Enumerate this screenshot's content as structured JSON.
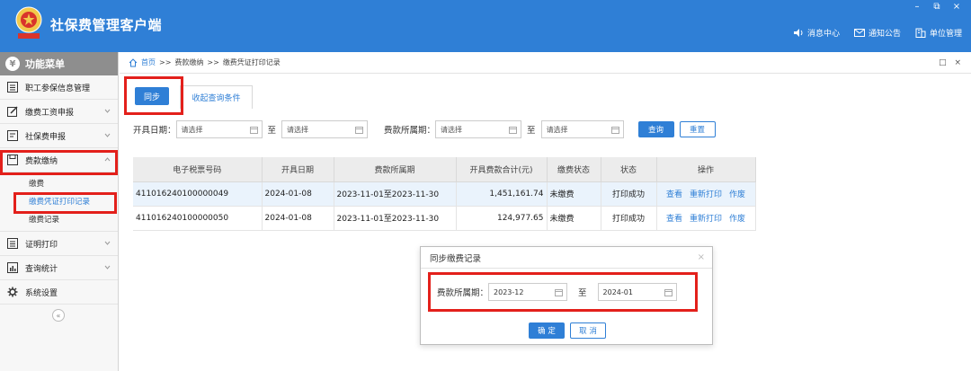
{
  "app": {
    "title": "社保费管理客户端",
    "window_controls": [
      "–",
      "⧉",
      "×"
    ],
    "header_links": [
      {
        "label": "消息中心",
        "icon": "speaker-icon"
      },
      {
        "label": "通知公告",
        "icon": "mail-icon"
      },
      {
        "label": "单位管理",
        "icon": "building-icon"
      }
    ]
  },
  "sidebar": {
    "title": "功能菜单",
    "items": [
      {
        "label": "职工参保信息管理",
        "icon": "list-icon",
        "has_chevron": false
      },
      {
        "label": "缴费工资申报",
        "icon": "edit-icon",
        "has_chevron": true
      },
      {
        "label": "社保费申报",
        "icon": "form-icon",
        "has_chevron": true
      },
      {
        "label": "费款缴纳",
        "icon": "save-icon",
        "has_chevron": true,
        "expanded": true
      },
      {
        "label": "证明打印",
        "icon": "print-icon",
        "has_chevron": true
      },
      {
        "label": "查询统计",
        "icon": "chart-icon",
        "has_chevron": true
      },
      {
        "label": "系统设置",
        "icon": "gear-icon",
        "has_chevron": false
      }
    ],
    "subitems": [
      {
        "label": "缴费",
        "active": false
      },
      {
        "label": "缴费凭证打印记录",
        "active": true
      },
      {
        "label": "缴费记录",
        "active": false
      }
    ],
    "collapse_symbol": "«"
  },
  "breadcrumb": {
    "home": "首页",
    "sep": ">>",
    "level1": "费款缴纳",
    "level2": "缴费凭证打印记录",
    "close_symbols": "□ ×"
  },
  "toolbar": {
    "sync_label": "同步",
    "tab_label": "收起查询条件"
  },
  "filters": {
    "issue_date_label": "开具日期：",
    "to_label": "至",
    "period_label": "费款所属期：",
    "placeholder": "请选择",
    "query_label": "查询",
    "reset_label": "重置"
  },
  "table": {
    "headers": [
      "电子税票号码",
      "开具日期",
      "费款所属期",
      "开具费款合计(元)",
      "缴费状态",
      "状态",
      "操作"
    ],
    "rows": [
      {
        "ticket": "411016240100000049",
        "date": "2024-01-08",
        "period": "2023-11-01至2023-11-30",
        "amount": "1,451,161.74",
        "pay_status": "未缴费",
        "status": "打印成功",
        "ops": [
          "查看",
          "重新打印",
          "作废"
        ]
      },
      {
        "ticket": "411016240100000050",
        "date": "2024-01-08",
        "period": "2023-11-01至2023-11-30",
        "amount": "124,977.65",
        "pay_status": "未缴费",
        "status": "打印成功",
        "ops": [
          "查看",
          "重新打印",
          "作废"
        ]
      }
    ]
  },
  "dialog": {
    "title": "同步缴费记录",
    "close_symbol": "×",
    "period_label": "费款所属期：",
    "from_value": "2023-12",
    "to_label": "至",
    "to_value": "2024-01",
    "confirm_label": "确 定",
    "cancel_label": "取 消"
  },
  "colors": {
    "header_blue": "#2f7fd6",
    "highlight_red": "#e3201b",
    "sidebar_head": "#8e8e8e",
    "link_blue": "#2f7fd6"
  }
}
